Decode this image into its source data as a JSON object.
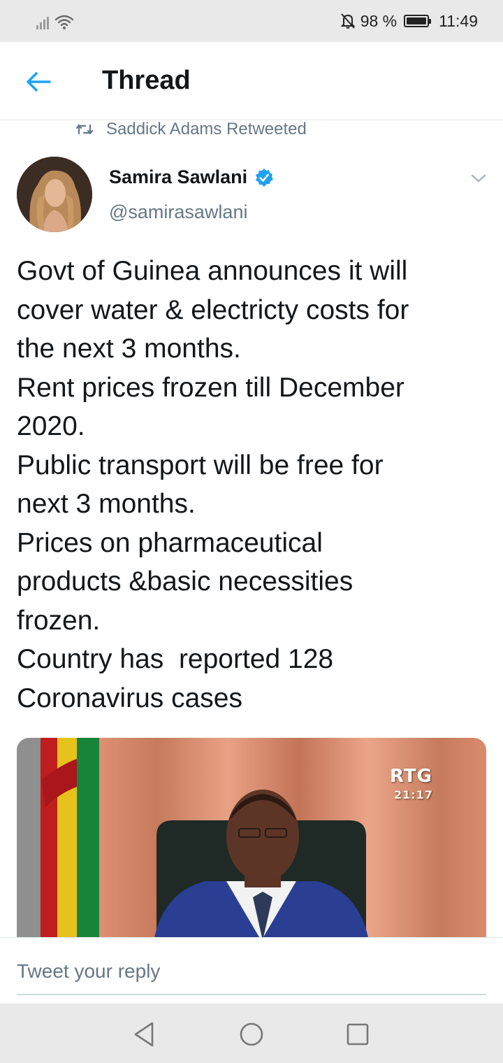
{
  "status_bar": {
    "battery_percent": "98 %",
    "battery_level": 0.98,
    "time": "11:49",
    "icons": [
      "signal-icon",
      "wifi-icon",
      "mute-icon",
      "battery-icon"
    ]
  },
  "header": {
    "title": "Thread",
    "back_icon": "arrow-left-icon",
    "accent_color": "#1da1f2"
  },
  "retweet_context": {
    "icon": "retweet-icon",
    "text": "Saddick Adams Retweeted"
  },
  "tweet": {
    "author": {
      "name": "Samira Sawlani",
      "handle": "@samirasawlani",
      "verified": true
    },
    "text_lines": [
      "Govt of Guinea announces it will",
      "cover water & electricty costs for",
      "the next 3 months.",
      "Rent prices frozen till December",
      "2020.",
      "Public transport will be free for",
      "next 3 months.",
      "Prices on pharmaceutical",
      "products &basic necessities",
      "frozen.",
      "Country has  reported 128",
      "Coronavirus cases"
    ],
    "media": {
      "channel_logo": "RTG",
      "timestamp": "21:17"
    }
  },
  "reply": {
    "placeholder": "Tweet your reply"
  },
  "nav_bar": {
    "buttons": [
      "back-triangle-icon",
      "home-circle-icon",
      "recents-square-icon"
    ]
  }
}
